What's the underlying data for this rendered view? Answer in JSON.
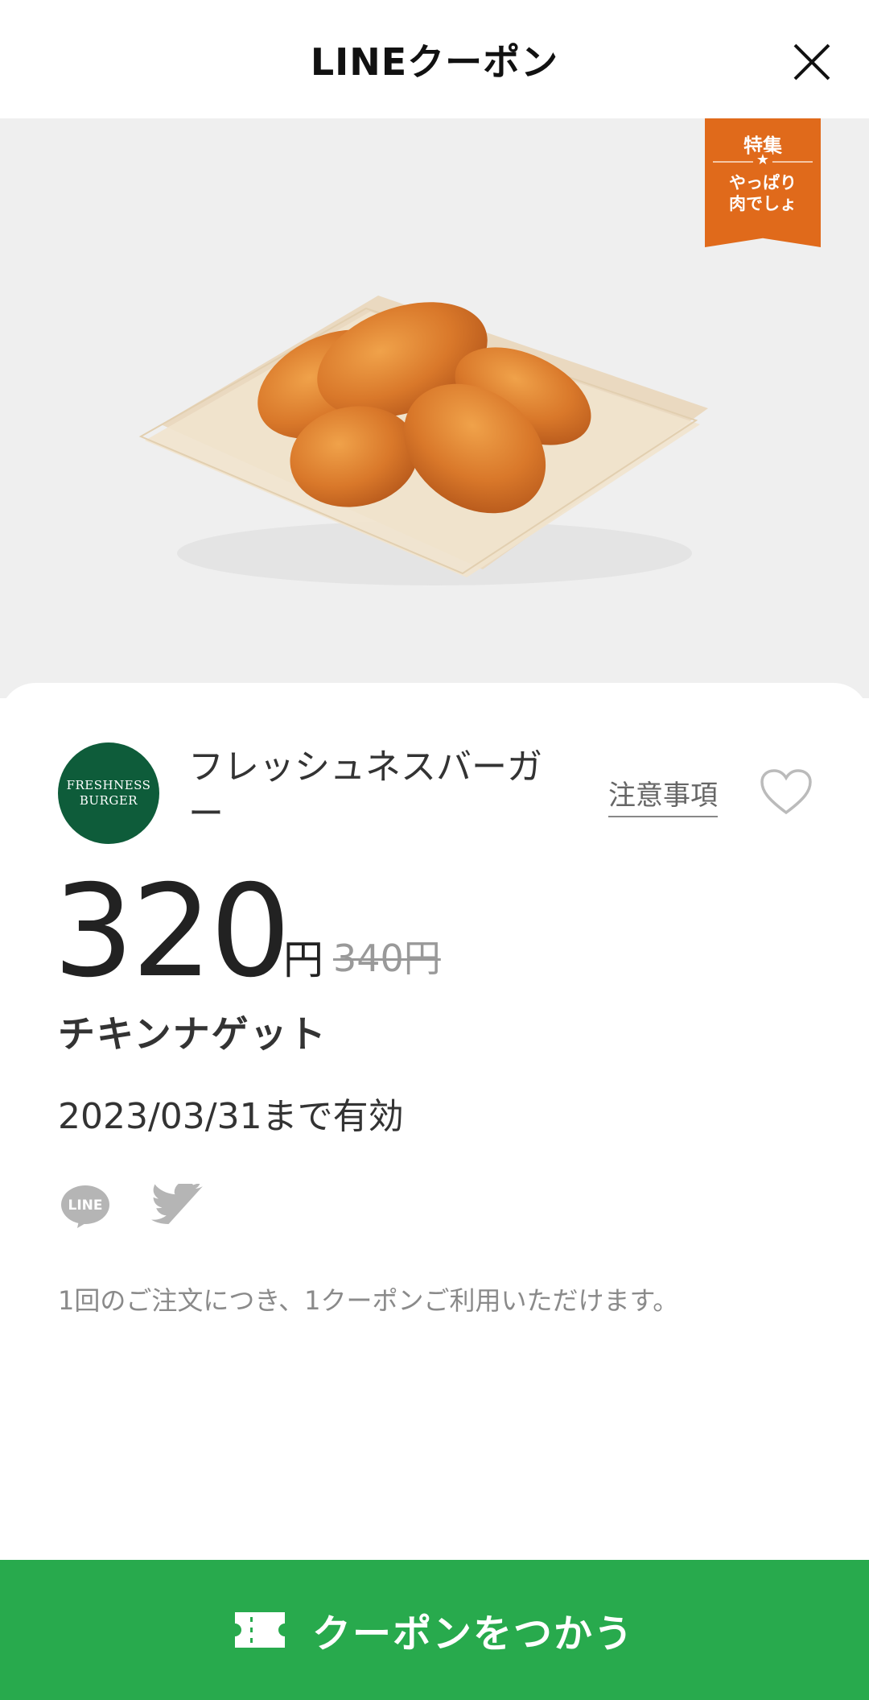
{
  "header": {
    "title": "LINEクーポン",
    "close_icon": "close-icon"
  },
  "hero": {
    "ribbon_top": "特集",
    "ribbon_star": "★",
    "ribbon_line1": "やっぱり",
    "ribbon_line2": "肉でしょ",
    "ribbon_color": "#e06a1b"
  },
  "shop": {
    "logo_line1": "FRESHNESS",
    "logo_line2": "BURGER",
    "logo_color": "#0e5c3a",
    "name": "フレッシュネスバーガー",
    "notes_label": "注意事項",
    "favorite_icon": "heart-icon"
  },
  "coupon": {
    "price": "320",
    "unit": "円",
    "original_price": "340円",
    "product_name": "チキンナゲット",
    "valid_until": "2023/03/31まで有効",
    "usage_note": "1回のご注文につき、1クーポンご利用いただけます。"
  },
  "share": {
    "line_icon_text": "LINE",
    "twitter_icon": "twitter-icon"
  },
  "cta": {
    "label": "クーポンをつかう",
    "icon": "ticket-icon",
    "color": "#28aa4d"
  }
}
